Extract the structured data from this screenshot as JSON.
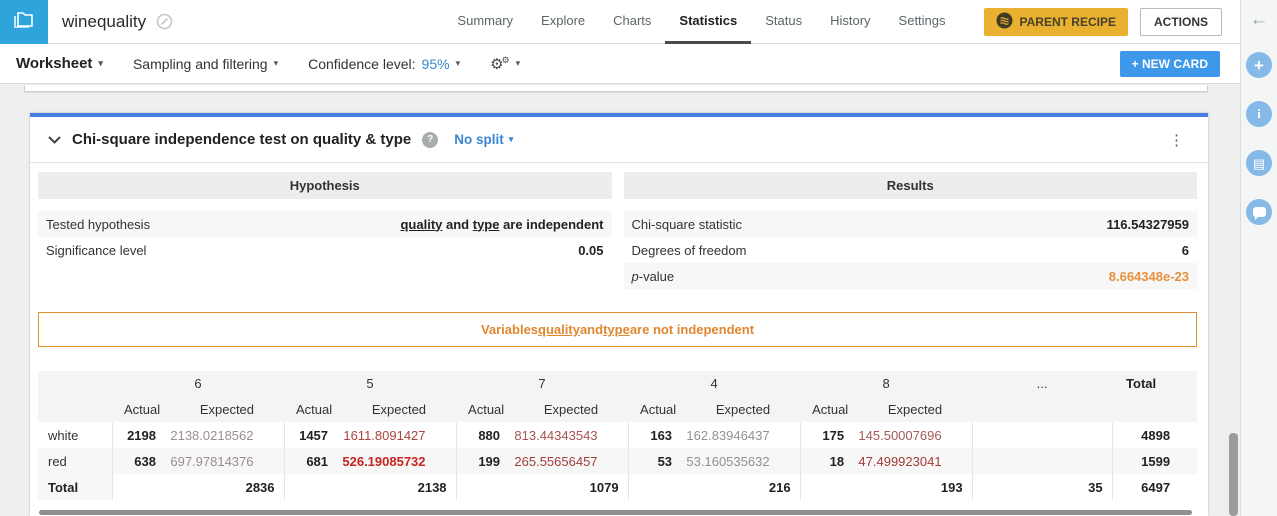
{
  "header": {
    "title": "winequality",
    "tabs": [
      {
        "label": "Summary",
        "active": false
      },
      {
        "label": "Explore",
        "active": false
      },
      {
        "label": "Charts",
        "active": false
      },
      {
        "label": "Statistics",
        "active": true
      },
      {
        "label": "Status",
        "active": false
      },
      {
        "label": "History",
        "active": false
      },
      {
        "label": "Settings",
        "active": false
      }
    ],
    "parent_recipe_label": "PARENT RECIPE",
    "actions_label": "ACTIONS"
  },
  "toolbar": {
    "worksheet_label": "Worksheet",
    "sampling_label": "Sampling and filtering",
    "confidence_label": "Confidence level:",
    "confidence_value": "95%",
    "new_card_label": "+ NEW CARD"
  },
  "card": {
    "title": "Chi-square independence test on quality & type",
    "help_glyph": "?",
    "split_label": "No split",
    "menu_glyph": "⋮",
    "hypothesis": {
      "title": "Hypothesis",
      "rows": [
        {
          "label_parts": [
            {
              "t": "Tested hypothesis"
            }
          ],
          "value_parts": [
            {
              "t": "quality",
              "u": true
            },
            {
              "t": " and "
            },
            {
              "t": "type",
              "u": true
            },
            {
              "t": " are independent"
            }
          ]
        },
        {
          "label_parts": [
            {
              "t": "Significance level"
            }
          ],
          "value_parts": [
            {
              "t": "0.05"
            }
          ]
        }
      ]
    },
    "results": {
      "title": "Results",
      "rows": [
        {
          "label_parts": [
            {
              "t": "Chi-square statistic"
            }
          ],
          "value_parts": [
            {
              "t": "116.54327959"
            }
          ]
        },
        {
          "label_parts": [
            {
              "t": "Degrees of freedom"
            }
          ],
          "value_parts": [
            {
              "t": "6"
            }
          ]
        },
        {
          "label_parts": [
            {
              "t": "p",
              "i": true
            },
            {
              "t": "-value"
            }
          ],
          "value_parts": [
            {
              "t": "8.664348e-23"
            }
          ],
          "value_class": "orange"
        }
      ]
    },
    "conclusion_parts": [
      {
        "t": "Variables "
      },
      {
        "t": "quality",
        "u": true
      },
      {
        "t": " and "
      },
      {
        "t": "type",
        "u": true
      },
      {
        "t": " are not independent"
      }
    ],
    "table": {
      "groups": [
        "6",
        "5",
        "7",
        "4",
        "8"
      ],
      "actual_label": "Actual",
      "expected_label": "Expected",
      "dots_label": "...",
      "total_label": "Total",
      "rows": [
        {
          "label": "white",
          "cells": [
            {
              "actual": "2198",
              "expected": "2138.0218562",
              "expected_color": "#9a8f8e",
              "strong": false
            },
            {
              "actual": "1457",
              "expected": "1611.8091427",
              "expected_color": "#ab4441",
              "strong": false
            },
            {
              "actual": "880",
              "expected": "813.44343543",
              "expected_color": "#a7534f",
              "strong": false
            },
            {
              "actual": "163",
              "expected": "162.83946437",
              "expected_color": "#95908f",
              "strong": false
            },
            {
              "actual": "175",
              "expected": "145.50007696",
              "expected_color": "#a45a56",
              "strong": false
            }
          ],
          "dots": "",
          "total": "4898"
        },
        {
          "label": "red",
          "cells": [
            {
              "actual": "638",
              "expected": "697.97814376",
              "expected_color": "#9a8c8b",
              "strong": false
            },
            {
              "actual": "681",
              "expected": "526.19085732",
              "expected_color": "#c8231e",
              "strong": true
            },
            {
              "actual": "199",
              "expected": "265.55656457",
              "expected_color": "#a03f3c",
              "strong": false
            },
            {
              "actual": "53",
              "expected": "53.160535632",
              "expected_color": "#95908f",
              "strong": false
            },
            {
              "actual": "18",
              "expected": "47.499923041",
              "expected_color": "#a03b38",
              "strong": false
            }
          ],
          "dots": "",
          "total": "1599"
        }
      ],
      "total_row": {
        "label": "Total",
        "group_totals": [
          "2836",
          "2138",
          "1079",
          "216",
          "193"
        ],
        "dots": "35",
        "total": "6497"
      }
    }
  },
  "colors": {
    "card_accent_blue": "#4a7de2",
    "link_blue": "#3a86d1",
    "warning_orange": "#e0872f",
    "pvalue_orange": "#e8913c",
    "new_card_blue": "#3d98ea",
    "parent_recipe_yellow": "#eab02f",
    "dataset_blue": "#2fa3dc",
    "deviation_red_strong": "#c8231e"
  }
}
